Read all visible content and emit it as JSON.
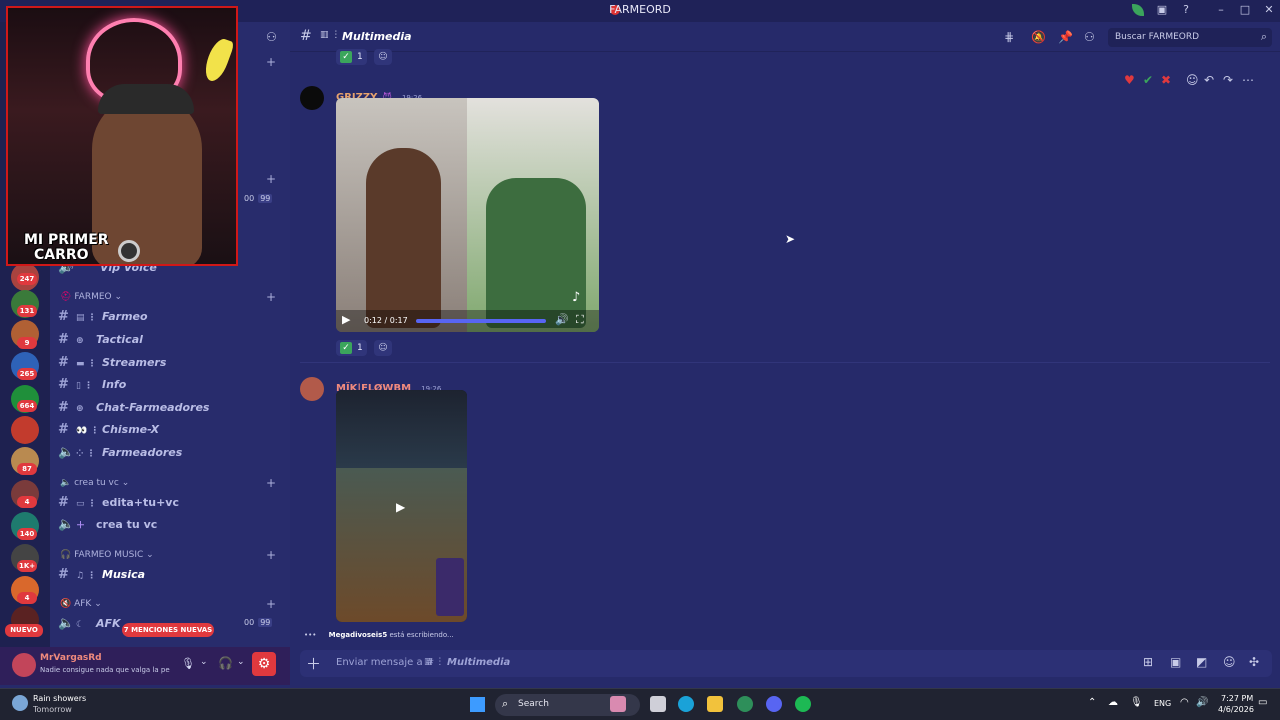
{
  "app": {
    "title": "FARMEORD"
  },
  "header": {
    "channel_name": "Multimedia",
    "search_placeholder": "Buscar FARMEORD"
  },
  "sidebar": {
    "categories": [
      {
        "label": "FARMEO"
      },
      {
        "label": "crea tu vc"
      },
      {
        "label": "FARMEO MUSIC"
      },
      {
        "label": "AFK"
      }
    ],
    "channels": [
      {
        "label": "Vip Voice"
      },
      {
        "label": "Farmeo"
      },
      {
        "label": "Tactical"
      },
      {
        "label": "Streamers"
      },
      {
        "label": "Info"
      },
      {
        "label": "Chat-Farmeadores"
      },
      {
        "label": "Chisme-X"
      },
      {
        "label": "Farmeadores"
      },
      {
        "label": "edita+tu+vc"
      },
      {
        "label": "crea tu vc"
      },
      {
        "label": "Musica"
      },
      {
        "label": "AFK"
      }
    ],
    "voice_counts": [
      {
        "a": "00",
        "b": "99"
      },
      {
        "a": "00",
        "b": "99"
      }
    ],
    "mentions_pill": "7 MENCIONES NUEVAS",
    "new_pill": "NUEVO"
  },
  "server_badges": [
    "247",
    "131",
    "9",
    "265",
    "664",
    "",
    "87",
    "4",
    "140",
    "1K+",
    "4",
    ""
  ],
  "webcam": {
    "overlay_line1": "MI PRIMER",
    "overlay_line2": "CARRO"
  },
  "messages": [
    {
      "author": "GRIZZY",
      "time": "19:26",
      "video_time": "0:12 / 0:17",
      "reaction_count": "1"
    },
    {
      "author": "MÏK|FLØWBM",
      "time": "19:26"
    }
  ],
  "top_reaction_count": "1",
  "typing": {
    "user": "Megadivoseis5",
    "text": "está escribiendo..."
  },
  "composer": {
    "placeholder_prefix": "Enviar mensaje a #",
    "channel": "Multimedia"
  },
  "user": {
    "name": "MrVargasRd",
    "status": "Nadie consigue nada que valga la pen"
  },
  "taskbar": {
    "weather_title": "Rain showers",
    "weather_sub": "Tomorrow",
    "search": "Search",
    "lang": "ENG",
    "time": "7:27 PM",
    "date": "4/6/2026"
  },
  "colors": {
    "accent": "#e0393e",
    "bg": "#262a6a",
    "sidebar": "#282c6c",
    "grizzy_name": "#e6a26d",
    "mik_name": "#f08a7d"
  }
}
